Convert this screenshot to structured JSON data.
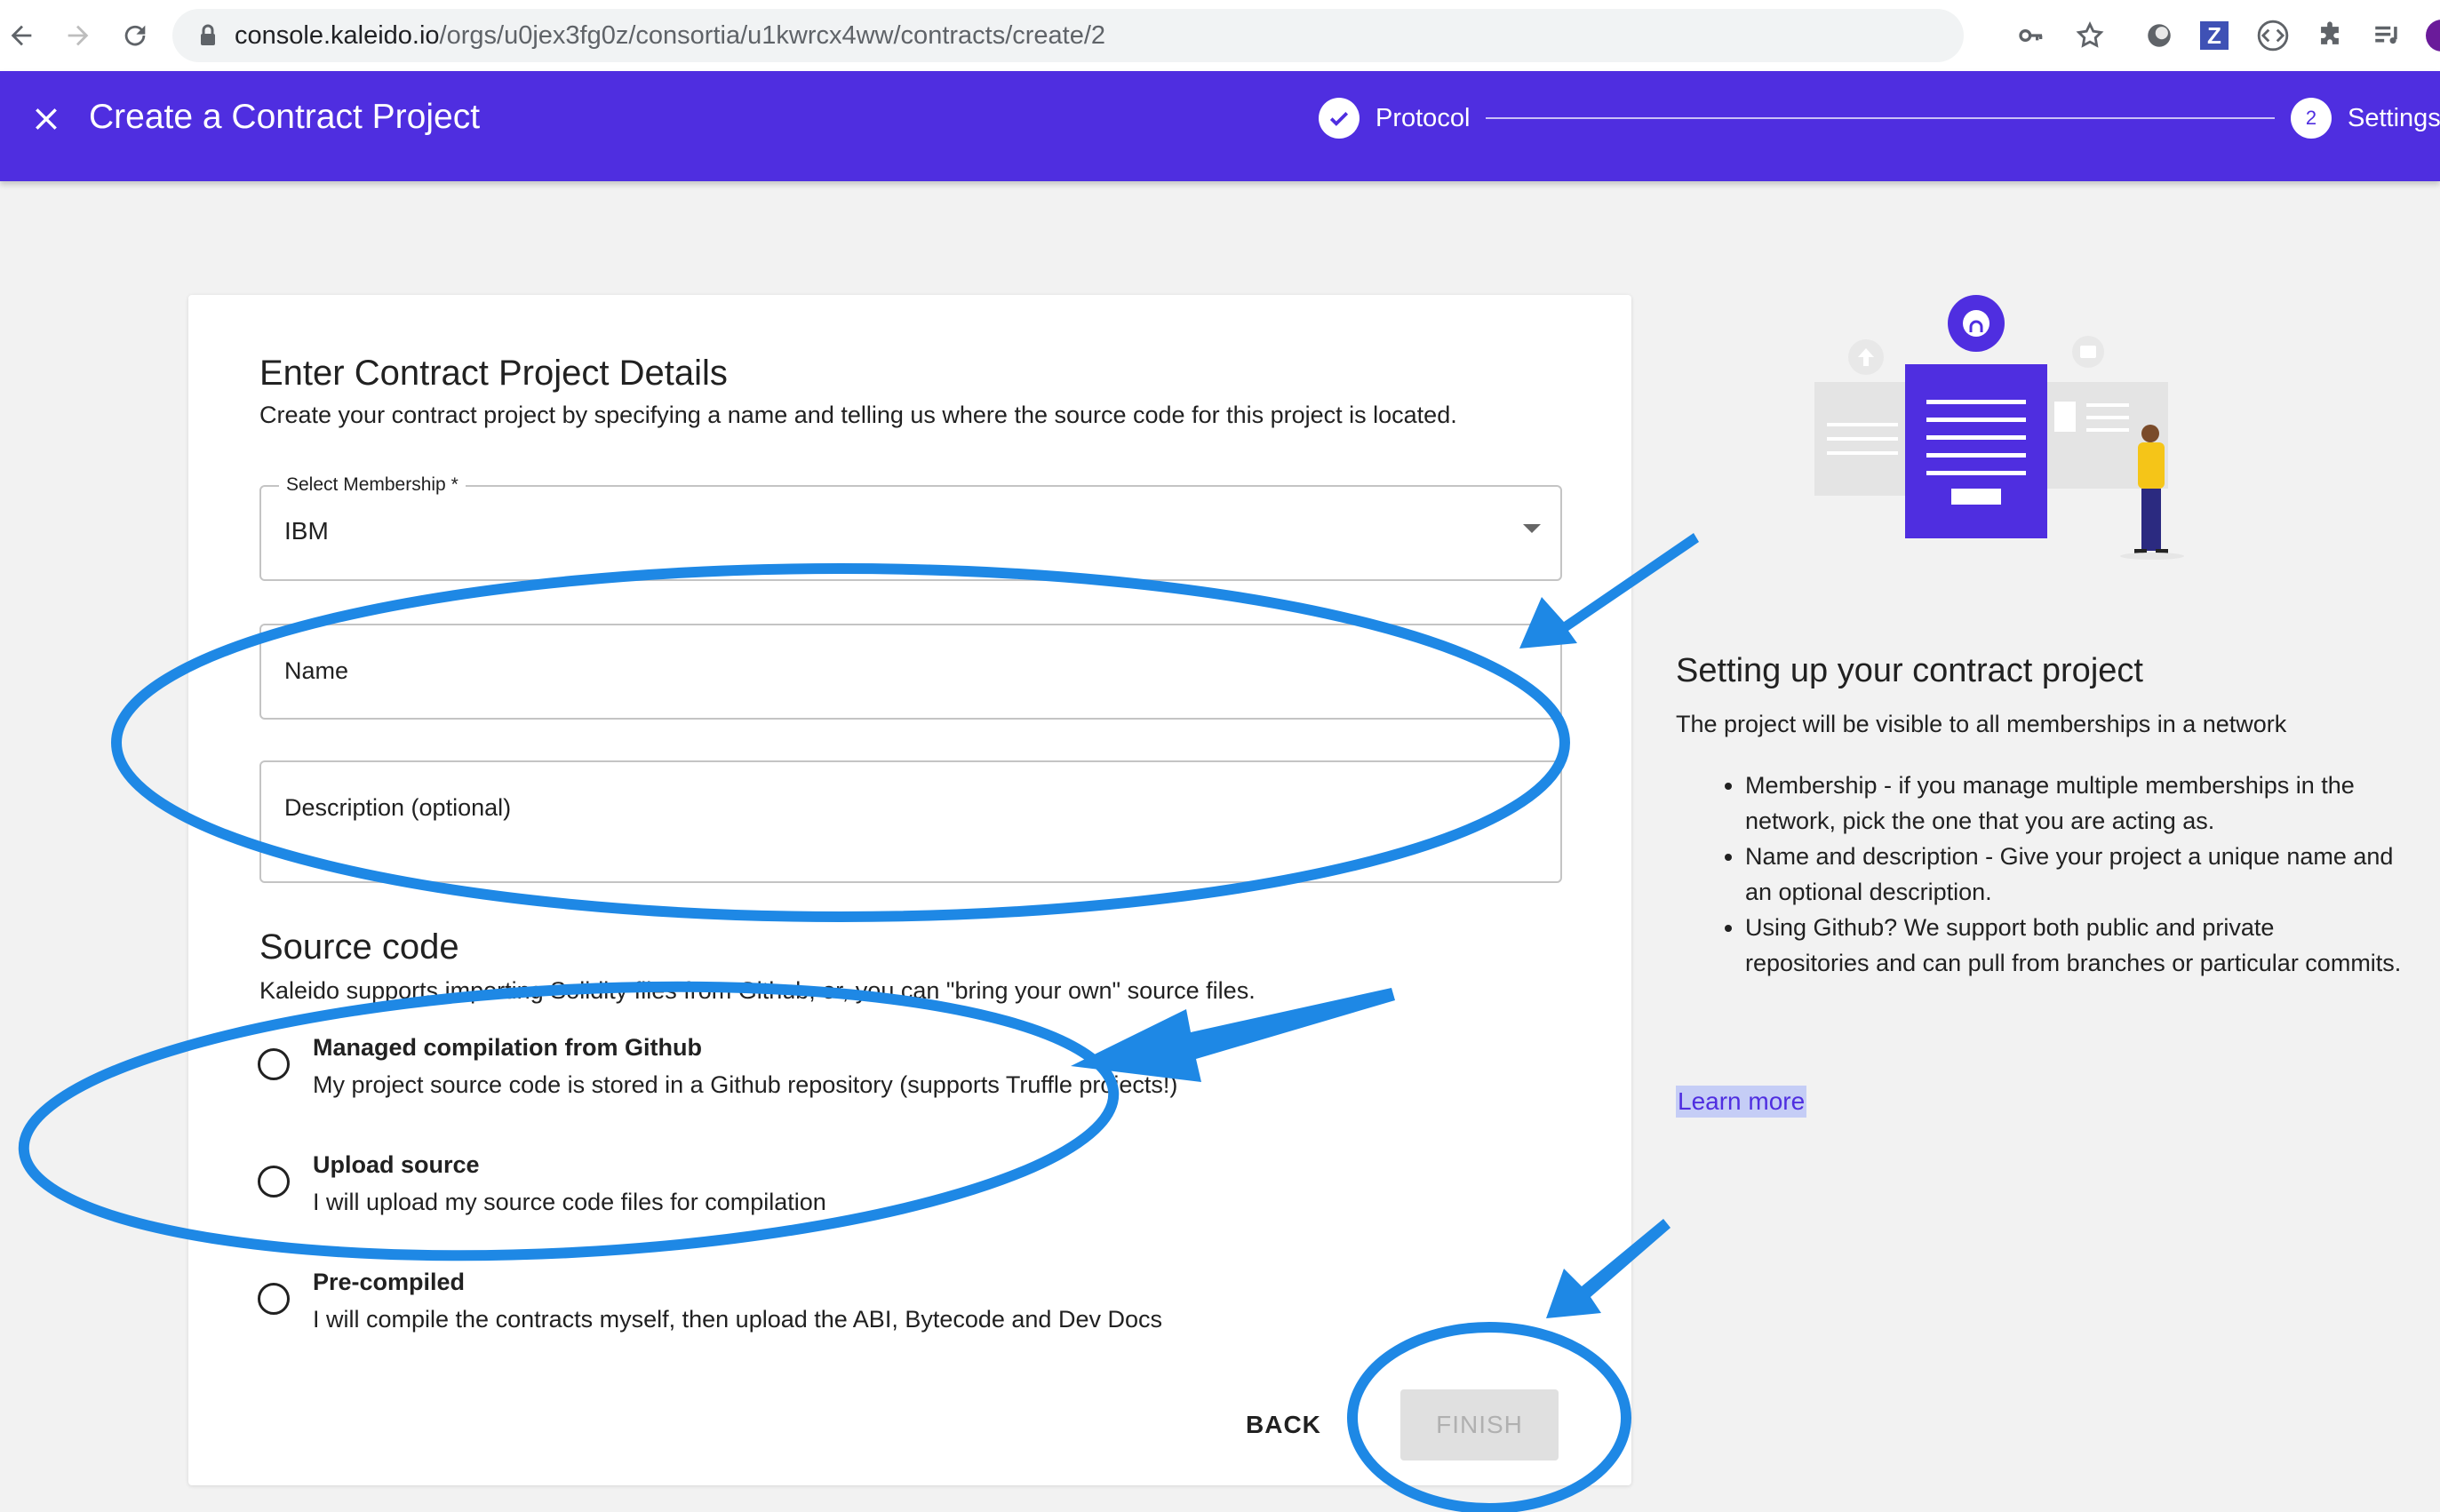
{
  "browser": {
    "url_host": "console.kaleido.io",
    "url_path": "/orgs/u0jex3fg0z/consortia/u1kwrcx4ww/contracts/create/2",
    "extension_z_label": "Z"
  },
  "header": {
    "title": "Create a Contract Project",
    "steps": [
      {
        "label": "Protocol",
        "state": "complete"
      },
      {
        "number": "2",
        "label": "Settings",
        "state": "active"
      }
    ],
    "background_color": "#4f2ee0"
  },
  "form": {
    "title": "Enter Contract Project Details",
    "subtitle": "Create your contract project by specifying a name and telling us where the source code for this project is located.",
    "membership": {
      "label": "Select Membership *",
      "value": "IBM"
    },
    "name_label": "Name",
    "description_label": "Description (optional)",
    "source": {
      "title": "Source code",
      "subtitle": "Kaleido supports importing Solidity files from Github, or, you can \"bring your own\" source files.",
      "options": [
        {
          "title": "Managed compilation from Github",
          "description": "My project source code is stored in a Github repository (supports Truffle projects!)"
        },
        {
          "title": "Upload source",
          "description": "I will upload my source code files for compilation"
        },
        {
          "title": "Pre-compiled",
          "description": "I will compile the contracts myself, then upload the ABI, Bytecode and Dev Docs"
        }
      ]
    },
    "back_label": "BACK",
    "finish_label": "FINISH"
  },
  "side_panel": {
    "title": "Setting up your contract project",
    "intro": "The project will be visible to all memberships in a network",
    "bullets": [
      "Membership - if you manage multiple memberships in the network, pick the one that you are acting as.",
      "Name and description - Give your project a unique name and an optional description.",
      "Using Github? We support both public and private repositories and can pull from branches or particular commits."
    ],
    "learn_more": "Learn more"
  },
  "annotation_color": "#1e88e5"
}
